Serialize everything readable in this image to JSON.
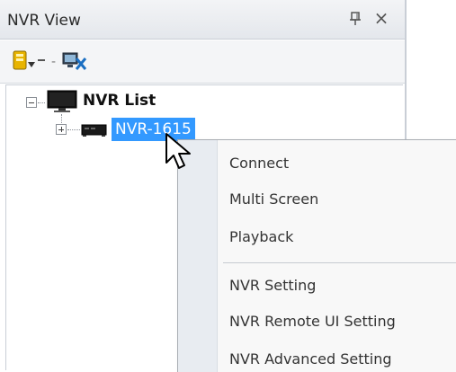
{
  "panel": {
    "title": "NVR View",
    "pin_glyph": "▫",
    "close_glyph": "×",
    "toolbar_separator": "-"
  },
  "tree": {
    "root_label": "NVR List",
    "root_icon": "monitor-icon",
    "child_label": "NVR-1615",
    "child_icon": "nvr-device-icon"
  },
  "context_menu": {
    "items": [
      {
        "label": "Connect",
        "has_submenu": true
      },
      {
        "label": "Multi Screen",
        "has_submenu": true
      },
      {
        "label": "Playback",
        "has_submenu": false
      },
      {
        "label": "NVR Setting",
        "has_submenu": false
      },
      {
        "label": "NVR Remote UI Setting",
        "has_submenu": false
      },
      {
        "label": "NVR Advanced Setting",
        "has_submenu": false
      }
    ]
  },
  "colors": {
    "selection": "#3399ff",
    "menu_bg": "#f8f8f8",
    "menu_gutter": "#e8ecf1"
  }
}
